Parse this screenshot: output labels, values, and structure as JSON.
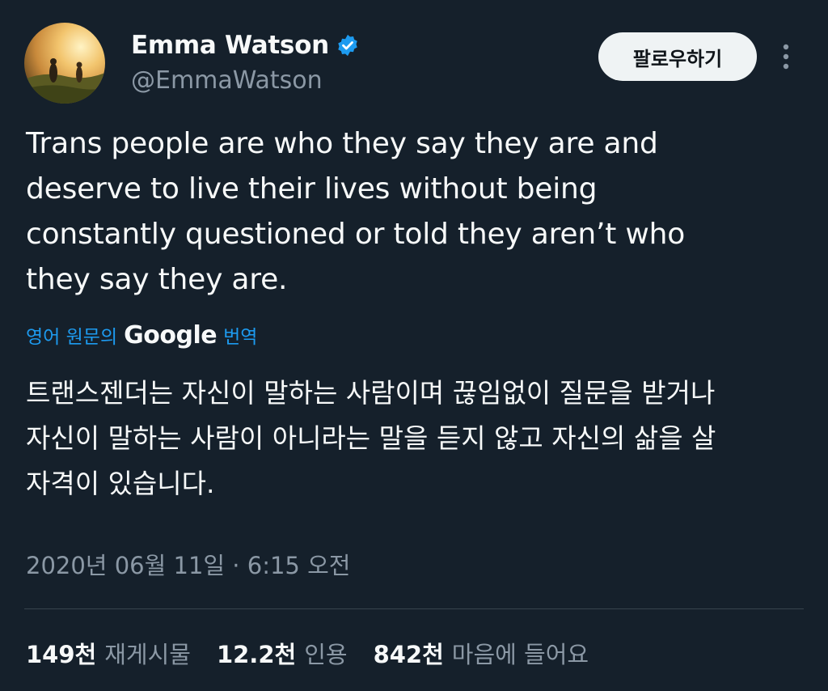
{
  "user": {
    "display_name": "Emma Watson",
    "handle": "@EmmaWatson",
    "verified": true,
    "avatar_icon": "profile-photo-sunset-icon"
  },
  "header": {
    "follow_label": "팔로우하기",
    "more_icon": "more-vertical-icon"
  },
  "tweet": {
    "text": "Trans people are who they say they are and\ndeserve to live their lives without being\nconstantly questioned or told they aren’t who\nthey say they are.",
    "translate_prefix": "영어 원문의",
    "translate_brand": "Google",
    "translate_suffix": "번역",
    "translated_text": "트랜스젠더는 자신이 말하는 사람이며 끊임없이 질문을 받거나\n자신이 말하는 사람이 아니라는 말을 듣지 않고 자신의 삶을 살\n자격이 있습니다.",
    "timestamp": "2020년 06월 11일 · 6:15 오전"
  },
  "stats": [
    {
      "value": "149천",
      "label": "재게시물"
    },
    {
      "value": "12.2천",
      "label": "인용"
    },
    {
      "value": "842천",
      "label": "마음에 들어요"
    }
  ],
  "colors": {
    "background": "#15202b",
    "primary_text": "#f7f9f9",
    "secondary_text": "#8b98a5",
    "link": "#1d9bf0",
    "verified_badge": "#1d9bf0",
    "follow_button_bg": "#eff3f4"
  }
}
